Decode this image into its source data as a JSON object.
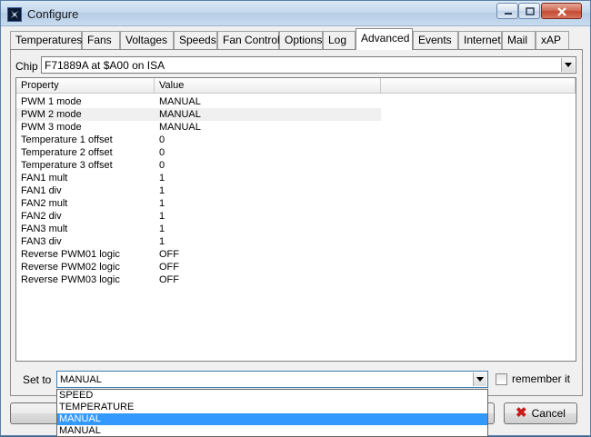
{
  "window": {
    "title": "Configure"
  },
  "tabs": [
    {
      "label": "Temperatures"
    },
    {
      "label": "Fans"
    },
    {
      "label": "Voltages"
    },
    {
      "label": "Speeds"
    },
    {
      "label": "Fan Control"
    },
    {
      "label": "Options"
    },
    {
      "label": "Log"
    },
    {
      "label": "Advanced",
      "active": true
    },
    {
      "label": "Events"
    },
    {
      "label": "Internet"
    },
    {
      "label": "Mail"
    },
    {
      "label": "xAP"
    }
  ],
  "chip": {
    "label": "Chip",
    "value": "F71889A at $A00 on ISA"
  },
  "grid": {
    "headers": [
      "Property",
      "Value"
    ],
    "rows": [
      {
        "property": "PWM 1 mode",
        "value": "MANUAL"
      },
      {
        "property": "PWM 2 mode",
        "value": "MANUAL",
        "selected": true
      },
      {
        "property": "PWM 3 mode",
        "value": "MANUAL"
      },
      {
        "property": "Temperature 1 offset",
        "value": "0"
      },
      {
        "property": "Temperature 2 offset",
        "value": "0"
      },
      {
        "property": "Temperature 3 offset",
        "value": "0"
      },
      {
        "property": "FAN1 mult",
        "value": "1"
      },
      {
        "property": "FAN1 div",
        "value": "1"
      },
      {
        "property": "FAN2 mult",
        "value": "1"
      },
      {
        "property": "FAN2 div",
        "value": "1"
      },
      {
        "property": "FAN3 mult",
        "value": "1"
      },
      {
        "property": "FAN3 div",
        "value": "1"
      },
      {
        "property": "Reverse PWM01 logic",
        "value": "OFF"
      },
      {
        "property": "Reverse PWM02 logic",
        "value": "OFF"
      },
      {
        "property": "Reverse PWM03 logic",
        "value": "OFF"
      }
    ]
  },
  "set_to": {
    "label": "Set to",
    "value": "MANUAL",
    "remember_label": "remember it",
    "remember_checked": false,
    "options": [
      {
        "label": "SPEED"
      },
      {
        "label": "TEMPERATURE"
      },
      {
        "label": "MANUAL",
        "highlighted": true
      },
      {
        "label": "MANUAL"
      }
    ]
  },
  "buttons": {
    "cancel": "Cancel"
  },
  "icons": {
    "app": "fan-app-icon",
    "cancel": "x-mark-icon",
    "dropdown": "chevron-down-icon"
  },
  "colors": {
    "highlight": "#3399ff",
    "cancel_x": "#c81a1a"
  }
}
